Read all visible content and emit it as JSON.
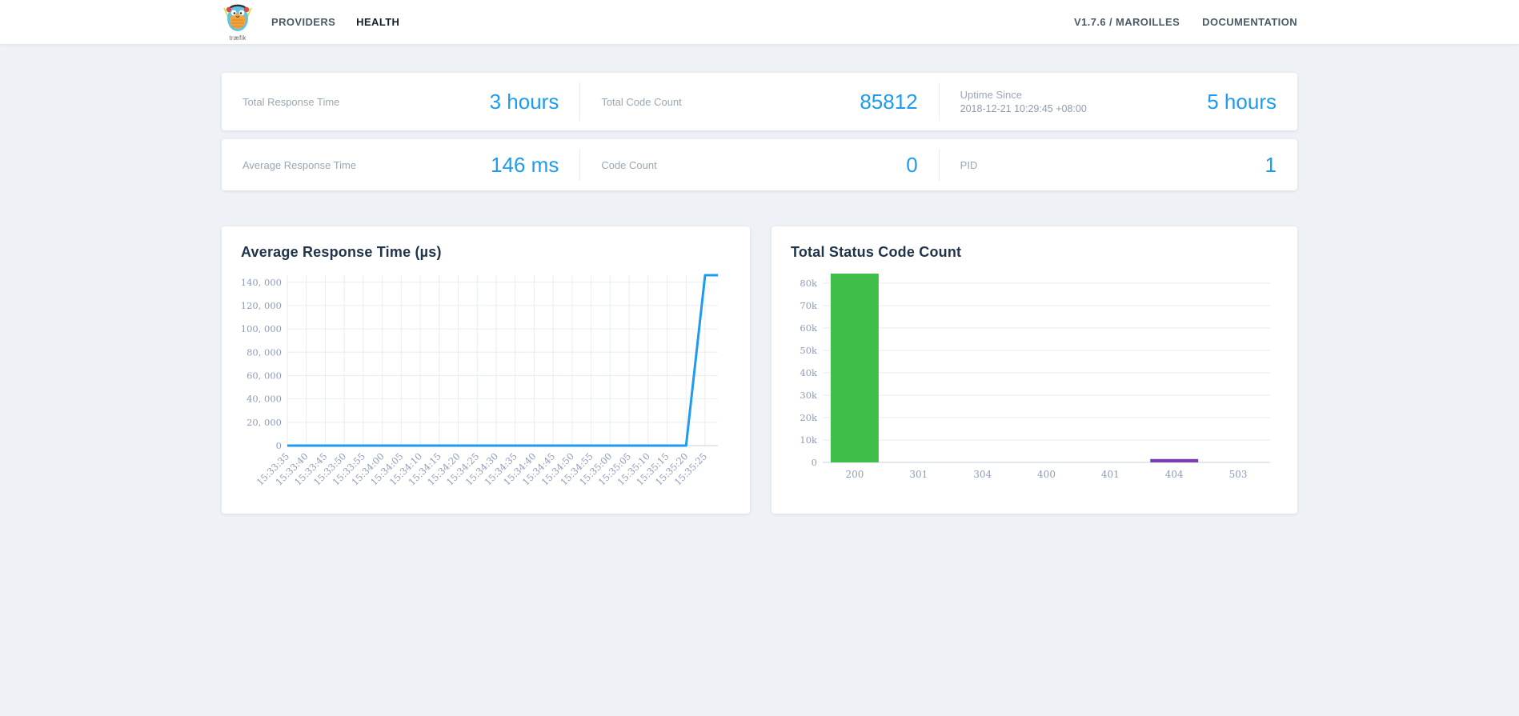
{
  "navbar": {
    "logo_text": "træfik",
    "links": {
      "providers": "PROVIDERS",
      "health": "HEALTH"
    },
    "version": "V1.7.6 / MAROILLES",
    "documentation": "DOCUMENTATION"
  },
  "stats": {
    "total_response_time": {
      "label": "Total Response Time",
      "value": "3 hours"
    },
    "total_code_count": {
      "label": "Total Code Count",
      "value": "85812"
    },
    "uptime": {
      "label": "Uptime Since",
      "sublabel": "2018-12-21 10:29:45 +08:00",
      "value": "5 hours"
    },
    "average_response_time": {
      "label": "Average Response Time",
      "value": "146 ms"
    },
    "code_count": {
      "label": "Code Count",
      "value": "0"
    },
    "pid": {
      "label": "PID",
      "value": "1"
    }
  },
  "colors": {
    "accent_blue": "#1d9bf0",
    "line_blue": "#1e9bf0",
    "bar_green": "#41bd4a",
    "bar_purple": "#7c3dae",
    "grid": "#e7edf3",
    "axis": "#c7d0da",
    "page_bg": "#eef2f6"
  },
  "chart_data": [
    {
      "type": "line",
      "title": "Average Response Time (µs)",
      "x": [
        "15:33:35",
        "15:33:40",
        "15:33:45",
        "15:33:50",
        "15:33:55",
        "15:34:00",
        "15:34:05",
        "15:34:10",
        "15:34:15",
        "15:34:20",
        "15:34:25",
        "15:34:30",
        "15:34:35",
        "15:34:40",
        "15:34:45",
        "15:34:50",
        "15:34:55",
        "15:35:00",
        "15:35:05",
        "15:35:10",
        "15:35:15",
        "15:35:20",
        "15:35:25"
      ],
      "values": [
        0,
        0,
        0,
        0,
        0,
        0,
        0,
        0,
        0,
        0,
        0,
        0,
        0,
        0,
        0,
        0,
        0,
        0,
        0,
        0,
        0,
        0,
        146000
      ],
      "ylim": [
        0,
        146000
      ],
      "yticks": [
        0,
        20000,
        40000,
        60000,
        80000,
        100000,
        120000,
        140000
      ],
      "ytick_labels": [
        "0",
        "20, 000",
        "40, 000",
        "60, 000",
        "80, 000",
        "100, 000",
        "120, 000",
        "140, 000"
      ],
      "line_color": "#1e9bf0",
      "grid": true,
      "legend": "none"
    },
    {
      "type": "bar",
      "title": "Total Status Code Count",
      "categories": [
        "200",
        "301",
        "304",
        "400",
        "401",
        "404",
        "503"
      ],
      "values": [
        84300,
        0,
        0,
        0,
        0,
        1512,
        0
      ],
      "bar_colors": [
        "#41bd4a",
        "",
        "",
        "",
        "",
        "#7c3dae",
        ""
      ],
      "ylim": [
        0,
        85000
      ],
      "yticks": [
        0,
        10000,
        20000,
        30000,
        40000,
        50000,
        60000,
        70000,
        80000
      ],
      "ytick_labels": [
        "0",
        "10k",
        "20k",
        "30k",
        "40k",
        "50k",
        "60k",
        "70k",
        "80k"
      ],
      "grid": true,
      "legend": "none"
    }
  ]
}
